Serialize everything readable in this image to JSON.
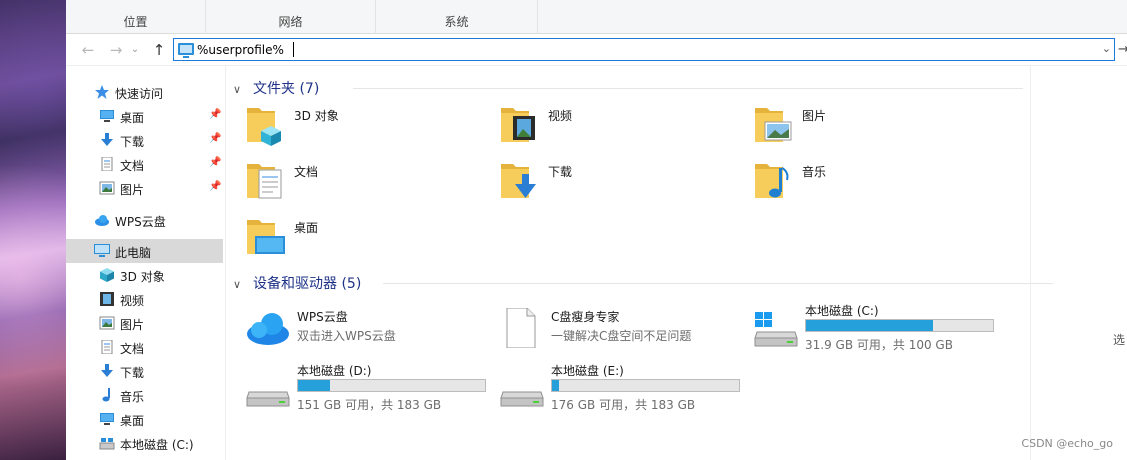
{
  "ribbon": {
    "groups": [
      "位置",
      "网络",
      "系统"
    ]
  },
  "address": {
    "value": "%userprofile%"
  },
  "sidebar": {
    "items": [
      {
        "label": "快速访问",
        "icon": "star-icon",
        "pinned": false,
        "selected": false
      },
      {
        "label": "桌面",
        "icon": "desktop-icon",
        "pinned": true,
        "selected": false
      },
      {
        "label": "下载",
        "icon": "download-icon",
        "pinned": true,
        "selected": false
      },
      {
        "label": "文档",
        "icon": "document-icon",
        "pinned": true,
        "selected": false
      },
      {
        "label": "图片",
        "icon": "picture-icon",
        "pinned": true,
        "selected": false
      },
      {
        "label": "WPS云盘",
        "icon": "cloud-icon",
        "pinned": false,
        "selected": false
      },
      {
        "label": "此电脑",
        "icon": "computer-icon",
        "pinned": false,
        "selected": true
      },
      {
        "label": "3D 对象",
        "icon": "cube-icon",
        "pinned": false,
        "selected": false
      },
      {
        "label": "视频",
        "icon": "video-icon",
        "pinned": false,
        "selected": false
      },
      {
        "label": "图片",
        "icon": "picture-icon",
        "pinned": false,
        "selected": false
      },
      {
        "label": "文档",
        "icon": "document-icon",
        "pinned": false,
        "selected": false
      },
      {
        "label": "下载",
        "icon": "download-icon",
        "pinned": false,
        "selected": false
      },
      {
        "label": "音乐",
        "icon": "music-icon",
        "pinned": false,
        "selected": false
      },
      {
        "label": "桌面",
        "icon": "desktop-icon",
        "pinned": false,
        "selected": false
      },
      {
        "label": "本地磁盘 (C:)",
        "icon": "drive-icon",
        "pinned": false,
        "selected": false
      }
    ]
  },
  "folders": {
    "header": "文件夹 (7)",
    "items": [
      {
        "label": "3D 对象",
        "icon": "cube-folder-icon"
      },
      {
        "label": "视频",
        "icon": "video-folder-icon"
      },
      {
        "label": "图片",
        "icon": "picture-folder-icon"
      },
      {
        "label": "文档",
        "icon": "document-folder-icon"
      },
      {
        "label": "下载",
        "icon": "download-folder-icon"
      },
      {
        "label": "音乐",
        "icon": "music-folder-icon"
      },
      {
        "label": "桌面",
        "icon": "desktop-folder-icon"
      }
    ]
  },
  "devices": {
    "header": "设备和驱动器 (5)",
    "items": [
      {
        "name": "WPS云盘",
        "subtitle": "双击进入WPS云盘",
        "icon": "wps-cloud-icon",
        "type": "app"
      },
      {
        "name": "C盘瘦身专家",
        "subtitle": "一键解决C盘空间不足问题",
        "icon": "blank-file-icon",
        "type": "app"
      },
      {
        "name": "本地磁盘 (C:)",
        "free": "31.9 GB 可用，共 100 GB",
        "used_fraction": 0.68,
        "icon": "windows-drive-icon",
        "type": "drive"
      },
      {
        "name": "本地磁盘 (D:)",
        "free": "151 GB 可用，共 183 GB",
        "used_fraction": 0.17,
        "icon": "drive-icon",
        "type": "drive"
      },
      {
        "name": "本地磁盘 (E:)",
        "free": "176 GB 可用，共 183 GB",
        "used_fraction": 0.04,
        "icon": "drive-icon",
        "type": "drive"
      }
    ]
  },
  "right_pane": {
    "hint": "选"
  },
  "watermark": "CSDN @echo_go",
  "colors": {
    "accent": "#1e78d7",
    "bar_fill": "#26a0da",
    "folder": "#f4c64e",
    "header_text": "#1e3287"
  }
}
